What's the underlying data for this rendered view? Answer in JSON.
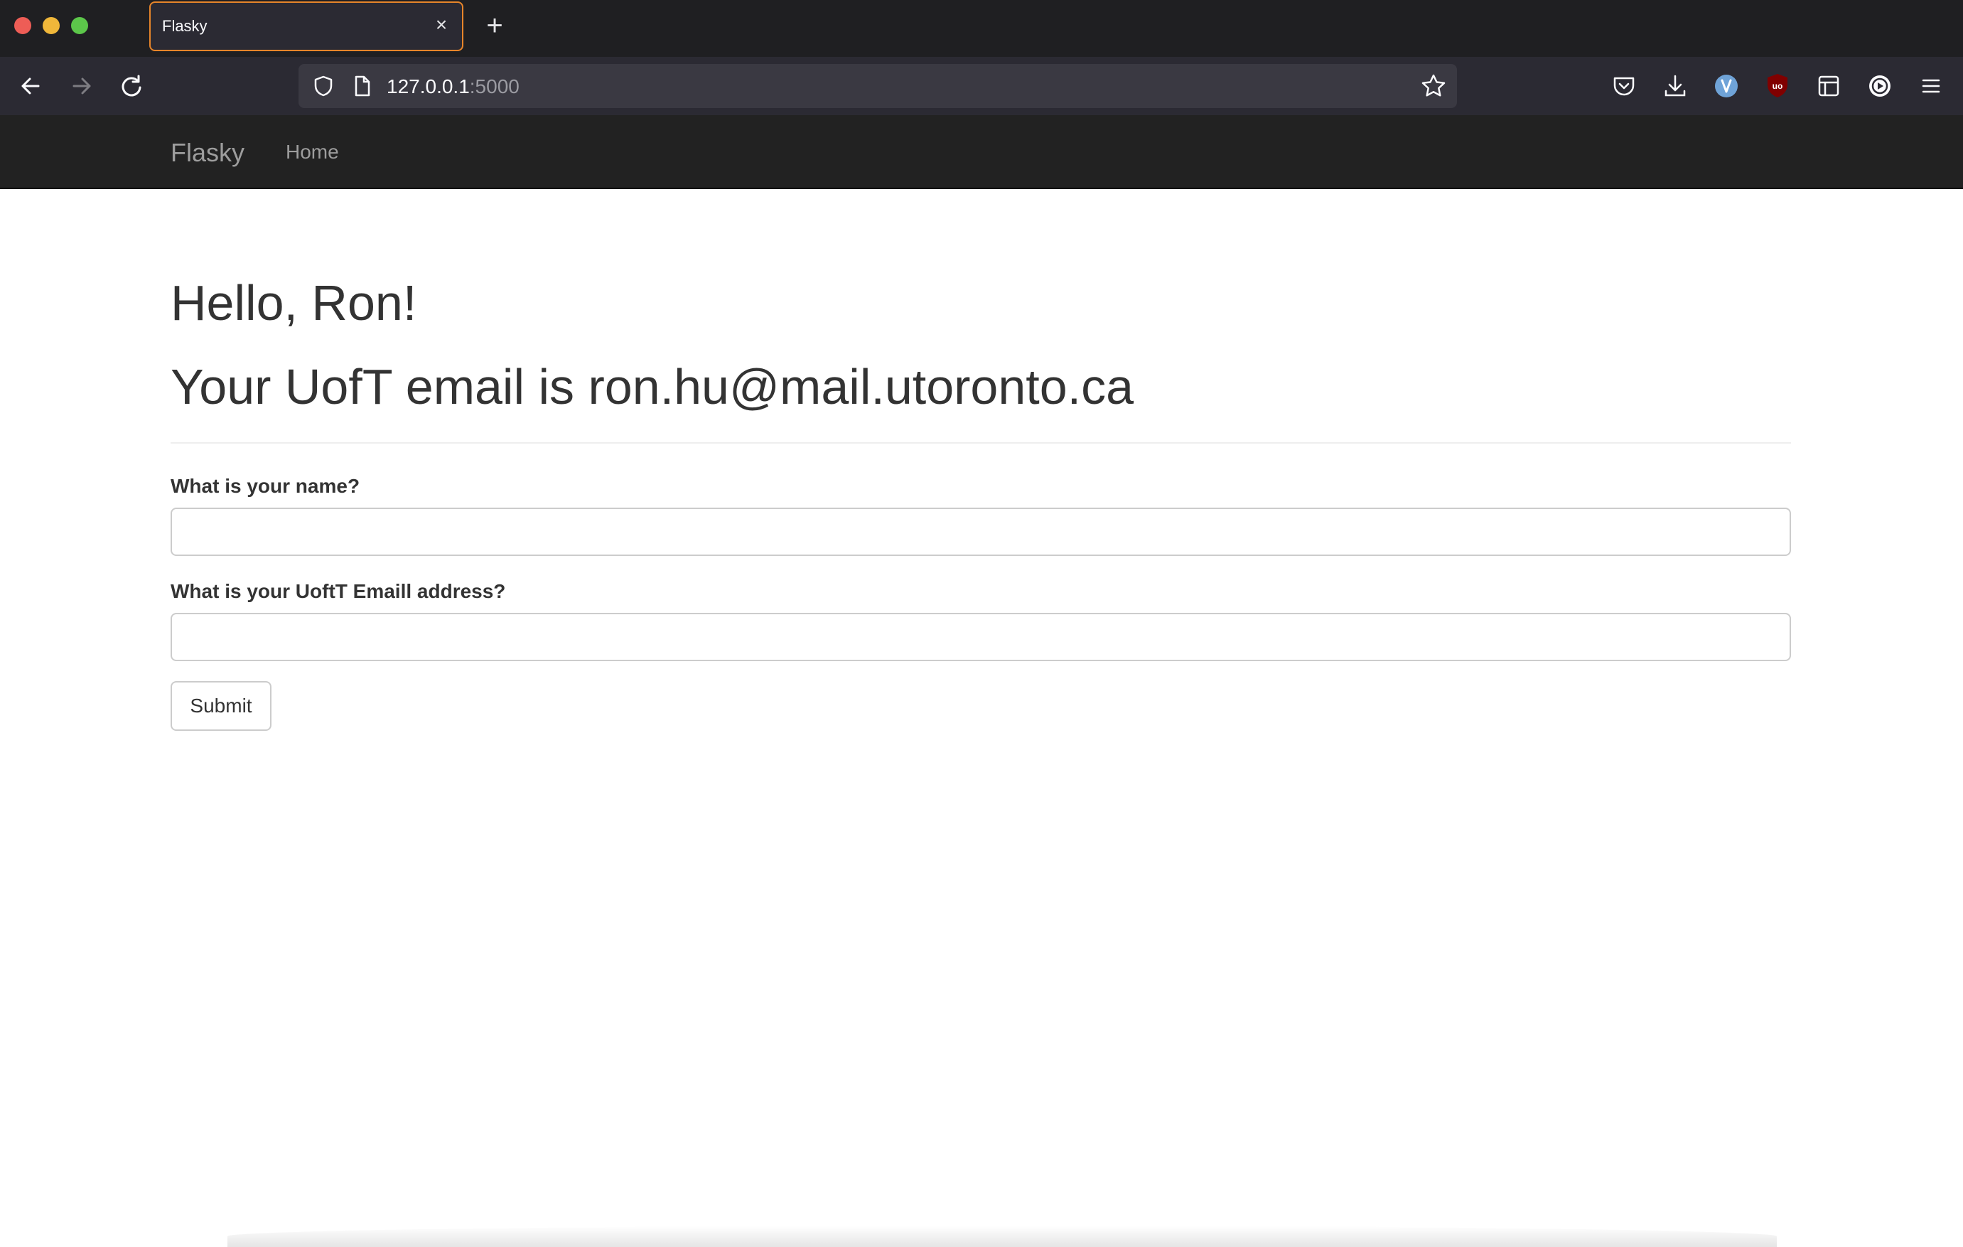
{
  "browser": {
    "tab_title": "Flasky",
    "close_glyph": "×",
    "new_tab_glyph": "+",
    "url_host": "127.0.0.1",
    "url_port": ":5000",
    "accent_color": "#e7852a"
  },
  "site": {
    "brand": "Flasky",
    "nav_home": "Home"
  },
  "page": {
    "greeting": "Hello, Ron!",
    "email_line": "Your UofT email is ron.hu@mail.utoronto.ca",
    "form": {
      "name_label": "What is your name?",
      "name_value": "",
      "email_label": "What is your UoftT Emaill address?",
      "email_value": "",
      "submit_label": "Submit"
    }
  },
  "icons": {
    "toolbar": [
      "back-icon",
      "forward-icon",
      "reload-icon",
      "shield-icon",
      "page-icon",
      "star-icon",
      "pocket-icon",
      "download-icon",
      "extension-icon",
      "ublock-icon",
      "reader-icon",
      "account-icon",
      "menu-icon"
    ]
  }
}
